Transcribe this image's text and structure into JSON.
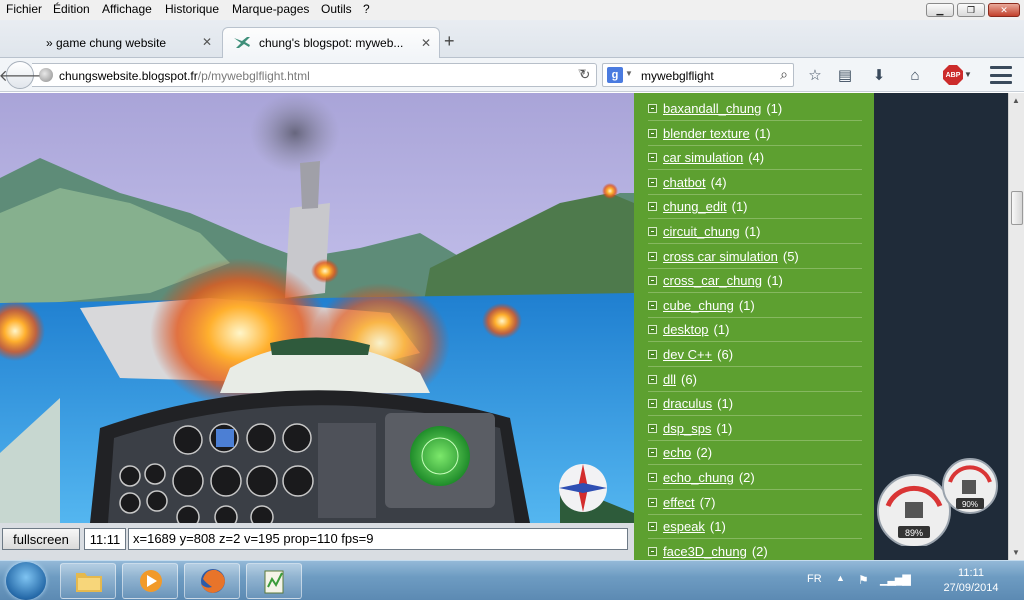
{
  "menubar": {
    "items": [
      "Fichier",
      "Édition",
      "Affichage",
      "Historique",
      "Marque-pages",
      "Outils",
      "?"
    ]
  },
  "tabs": [
    {
      "label": "» game chung website"
    },
    {
      "label": "chung's blogspot: myweb..."
    }
  ],
  "navbar": {
    "url_host": "chungswebsite.blogspot.fr",
    "url_path": "/p/mywebglflight.html",
    "search_value": "mywebglflight"
  },
  "game": {
    "fullscreen_label": "fullscreen",
    "time": "11:11",
    "status": "x=1689  y=808  z=2  v=195  prop=110 fps=9"
  },
  "sidebar": {
    "labels": [
      {
        "name": "baxandall_chung",
        "count": "(1)"
      },
      {
        "name": "blender texture",
        "count": "(1)"
      },
      {
        "name": "car simulation",
        "count": "(4)"
      },
      {
        "name": "chatbot",
        "count": "(4)"
      },
      {
        "name": "chung_edit",
        "count": "(1)"
      },
      {
        "name": "circuit_chung",
        "count": "(1)"
      },
      {
        "name": "cross car simulation",
        "count": "(5)"
      },
      {
        "name": "cross_car_chung",
        "count": "(1)"
      },
      {
        "name": "cube_chung",
        "count": "(1)"
      },
      {
        "name": "desktop",
        "count": "(1)"
      },
      {
        "name": "dev C++",
        "count": "(6)"
      },
      {
        "name": "dll",
        "count": "(6)"
      },
      {
        "name": "draculus",
        "count": "(1)"
      },
      {
        "name": "dsp_sps",
        "count": "(1)"
      },
      {
        "name": "echo",
        "count": "(2)"
      },
      {
        "name": "echo_chung",
        "count": "(2)"
      },
      {
        "name": "effect",
        "count": "(7)"
      },
      {
        "name": "espeak",
        "count": "(1)"
      },
      {
        "name": "face3D_chung",
        "count": "(2)"
      }
    ]
  },
  "gadgets": {
    "cpu": "89%",
    "ram": "90%"
  },
  "taskbar": {
    "language": "FR",
    "time": "11:11",
    "date": "27/09/2014"
  },
  "colors": {
    "sidebar_green": "#5da030",
    "page_dark": "#1f2b39",
    "taskbar_blue": "#6e9cc2"
  }
}
